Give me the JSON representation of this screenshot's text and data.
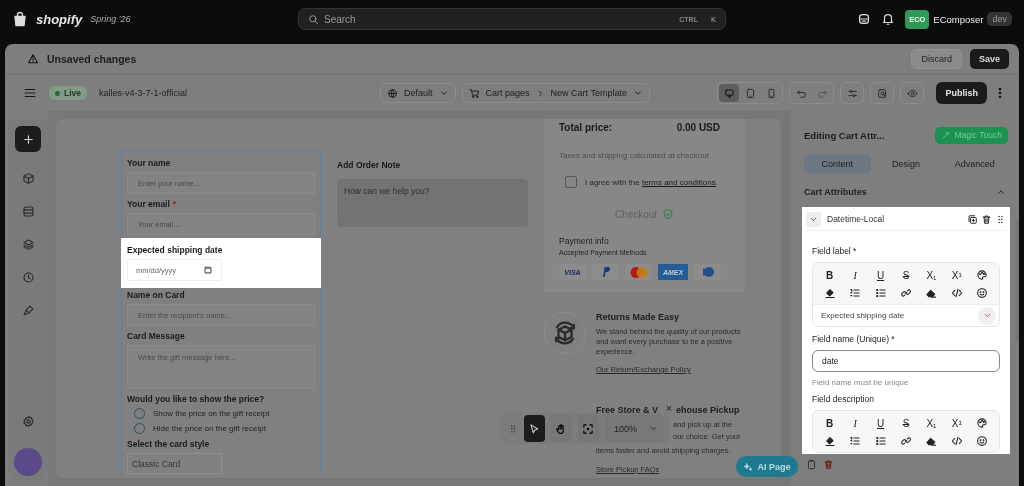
{
  "top_bar": {
    "brand": "shopify",
    "release": "Spring '26",
    "search": {
      "placeholder": "Search",
      "shortcut": [
        "CTRL",
        "K"
      ]
    },
    "account": {
      "initials": "ECO",
      "name": "EComposer",
      "tag": "dev"
    }
  },
  "notice": {
    "title": "Unsaved changes",
    "discard": "Discard",
    "save": "Save"
  },
  "toolbar": {
    "status": "Live",
    "theme": "kalles-v4-3-7-1-official",
    "language": "Default",
    "breadcrumb": [
      "Cart pages",
      "New Cart Template"
    ],
    "devices": [
      {
        "kind": "desktop",
        "selected": true
      },
      {
        "kind": "tablet",
        "selected": false
      },
      {
        "kind": "mobile",
        "selected": false
      }
    ],
    "publish": "Publish"
  },
  "form": {
    "fields": [
      {
        "kind": "text",
        "label": "Your name",
        "placeholder": "Enter your name...",
        "highlighted": false
      },
      {
        "kind": "text",
        "label": "Your email",
        "mark": "*",
        "placeholder": "Your email....",
        "highlighted": false
      },
      {
        "kind": "date",
        "label": "Expected shipping date",
        "placeholder": "mm/dd/yyyy",
        "highlighted": true
      },
      {
        "kind": "text",
        "label": "Name on Card",
        "placeholder": "Enter the recipient's name...",
        "highlighted": false
      },
      {
        "kind": "textarea",
        "label": "Card Message",
        "placeholder": "Write the gift message here...",
        "highlighted": false
      },
      {
        "kind": "radio",
        "label": "Would you like to show the price?",
        "highlighted": false,
        "options": [
          {
            "label": "Show the price on the gift receipt",
            "selected": false
          },
          {
            "label": "Hide the price on the gift receipt",
            "selected": false
          }
        ]
      },
      {
        "kind": "select",
        "label": "Select the card style",
        "value": "Classic Card",
        "highlighted": false
      }
    ]
  },
  "order_note": {
    "title": "Add Order Note",
    "placeholder": "How can we help you?"
  },
  "cart_summary": {
    "total_label": "Total price:",
    "total_value": "0.00 USD",
    "tax_note": "Taxes and shipping calculated at checkout",
    "agree": {
      "checked": false,
      "text": "I agree with the ",
      "link": "terms and conditions",
      "after": "."
    },
    "checkout": "Checkout",
    "payment_title": "Payment info",
    "payment_subtitle": "Accepted Payment Methods",
    "payment_methods": [
      {
        "kind": "visa",
        "label": "VISA"
      },
      {
        "kind": "paypal"
      },
      {
        "kind": "mastercard"
      },
      {
        "kind": "amex",
        "label": "AMEX"
      },
      {
        "kind": "diners"
      }
    ]
  },
  "features": [
    {
      "kind": "open",
      "title_parts": [
        "Returns Made Easy"
      ],
      "text_parts": [
        "We stand behind the quality of our products and want every purchase to be a positive experience."
      ],
      "link": "Our Return/Exchange Policy"
    },
    {
      "kind": "covered",
      "title_parts": [
        "Free Store & V",
        "ehouse Pickup"
      ],
      "text_parts": [
        "and pick up at the",
        "our choice. Get your",
        "items faster and avoid shipping charges."
      ],
      "link": "Store Pickup FAQs"
    }
  ],
  "canvas_tools": {
    "tools": [
      {
        "kind": "pointer",
        "selected": true
      },
      {
        "kind": "hand",
        "selected": false
      },
      {
        "kind": "fit",
        "selected": false
      }
    ],
    "zoom": "100%",
    "close": "×"
  },
  "ai_button": "AI Page",
  "panel": {
    "title": "Editing Cart Attr...",
    "magic": "Magic Touch",
    "tabs": [
      {
        "label": "Content",
        "selected": true
      },
      {
        "label": "Design",
        "selected": false
      },
      {
        "label": "Advanced",
        "selected": false
      }
    ],
    "section": {
      "title": "Cart Attributes",
      "expanded": true
    },
    "attribute": {
      "type": "Datetime-Local",
      "expanded": true,
      "label_title": "Field label *",
      "label_editor": {
        "value": "Expected shipping date",
        "tools": [
          {
            "kind": "bold",
            "text": "B"
          },
          {
            "kind": "italic",
            "text": "I"
          },
          {
            "kind": "underline",
            "text": "U"
          },
          {
            "kind": "strike",
            "text": "S"
          },
          {
            "kind": "subscript",
            "text": "X₁"
          },
          {
            "kind": "superscript",
            "text": "X¹"
          },
          {
            "kind": "palette"
          },
          {
            "kind": "fill"
          },
          {
            "kind": "ordered-list"
          },
          {
            "kind": "bullet-list"
          },
          {
            "kind": "link"
          },
          {
            "kind": "eraser"
          },
          {
            "kind": "code"
          },
          {
            "kind": "emoji"
          }
        ]
      },
      "name_title": "Field name (Unique) *",
      "name_value": "date",
      "name_hint": "Field name must be unique",
      "description_title": "Field description",
      "description_editor": {
        "tools": [
          {
            "kind": "bold",
            "text": "B"
          },
          {
            "kind": "italic",
            "text": "I"
          },
          {
            "kind": "underline",
            "text": "U"
          },
          {
            "kind": "strike",
            "text": "S"
          },
          {
            "kind": "subscript",
            "text": "X₁"
          },
          {
            "kind": "superscript",
            "text": "X¹"
          },
          {
            "kind": "palette"
          },
          {
            "kind": "fill"
          },
          {
            "kind": "ordered-list"
          },
          {
            "kind": "bullet-list"
          },
          {
            "kind": "link"
          },
          {
            "kind": "eraser"
          },
          {
            "kind": "code"
          },
          {
            "kind": "emoji"
          }
        ]
      }
    }
  }
}
